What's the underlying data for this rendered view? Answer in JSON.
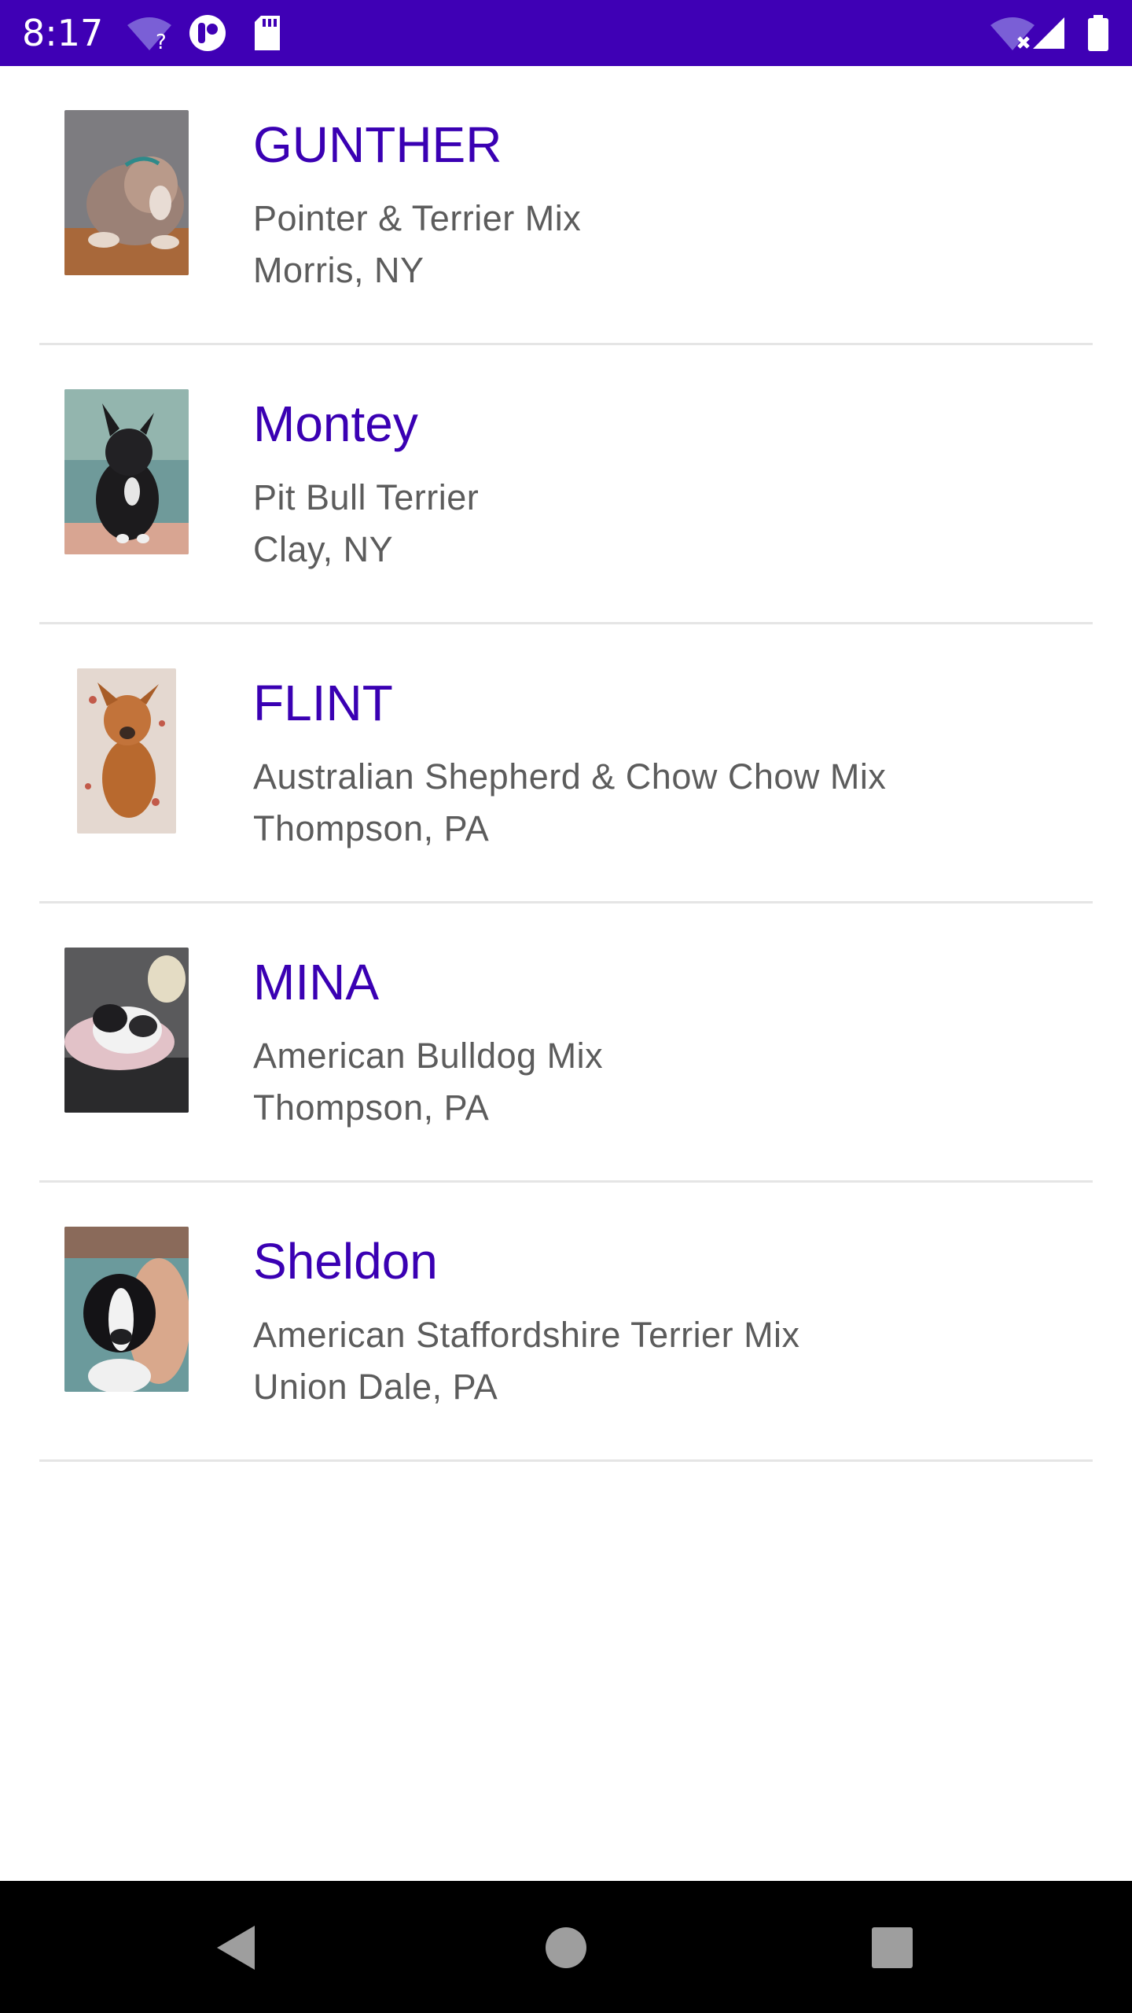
{
  "status_bar": {
    "time": "8:17",
    "background": "#3f00b5",
    "left_icons": [
      "wifi-unknown-icon",
      "app-notification-icon",
      "sd-card-icon"
    ],
    "right_icons": [
      "wifi-disconnected-icon",
      "cell-signal-icon",
      "battery-icon"
    ]
  },
  "accent_color": "#3a00b3",
  "pets": [
    {
      "name": "GUNTHER",
      "breed": " Pointer & Terrier Mix",
      "location": "Morris, NY"
    },
    {
      "name": "Montey",
      "breed": "Pit Bull Terrier",
      "location": "Clay, NY"
    },
    {
      "name": "FLINT",
      "breed": " Australian Shepherd & Chow Chow Mix",
      "location": " Thompson, PA"
    },
    {
      "name": "MINA",
      "breed": " American Bulldog Mix",
      "location": " Thompson, PA"
    },
    {
      "name": "Sheldon",
      "breed": " American Staffordshire Terrier Mix",
      "location": " Union Dale, PA"
    }
  ],
  "nav_bar": {
    "buttons": [
      "back-icon",
      "home-icon",
      "recents-icon"
    ]
  }
}
